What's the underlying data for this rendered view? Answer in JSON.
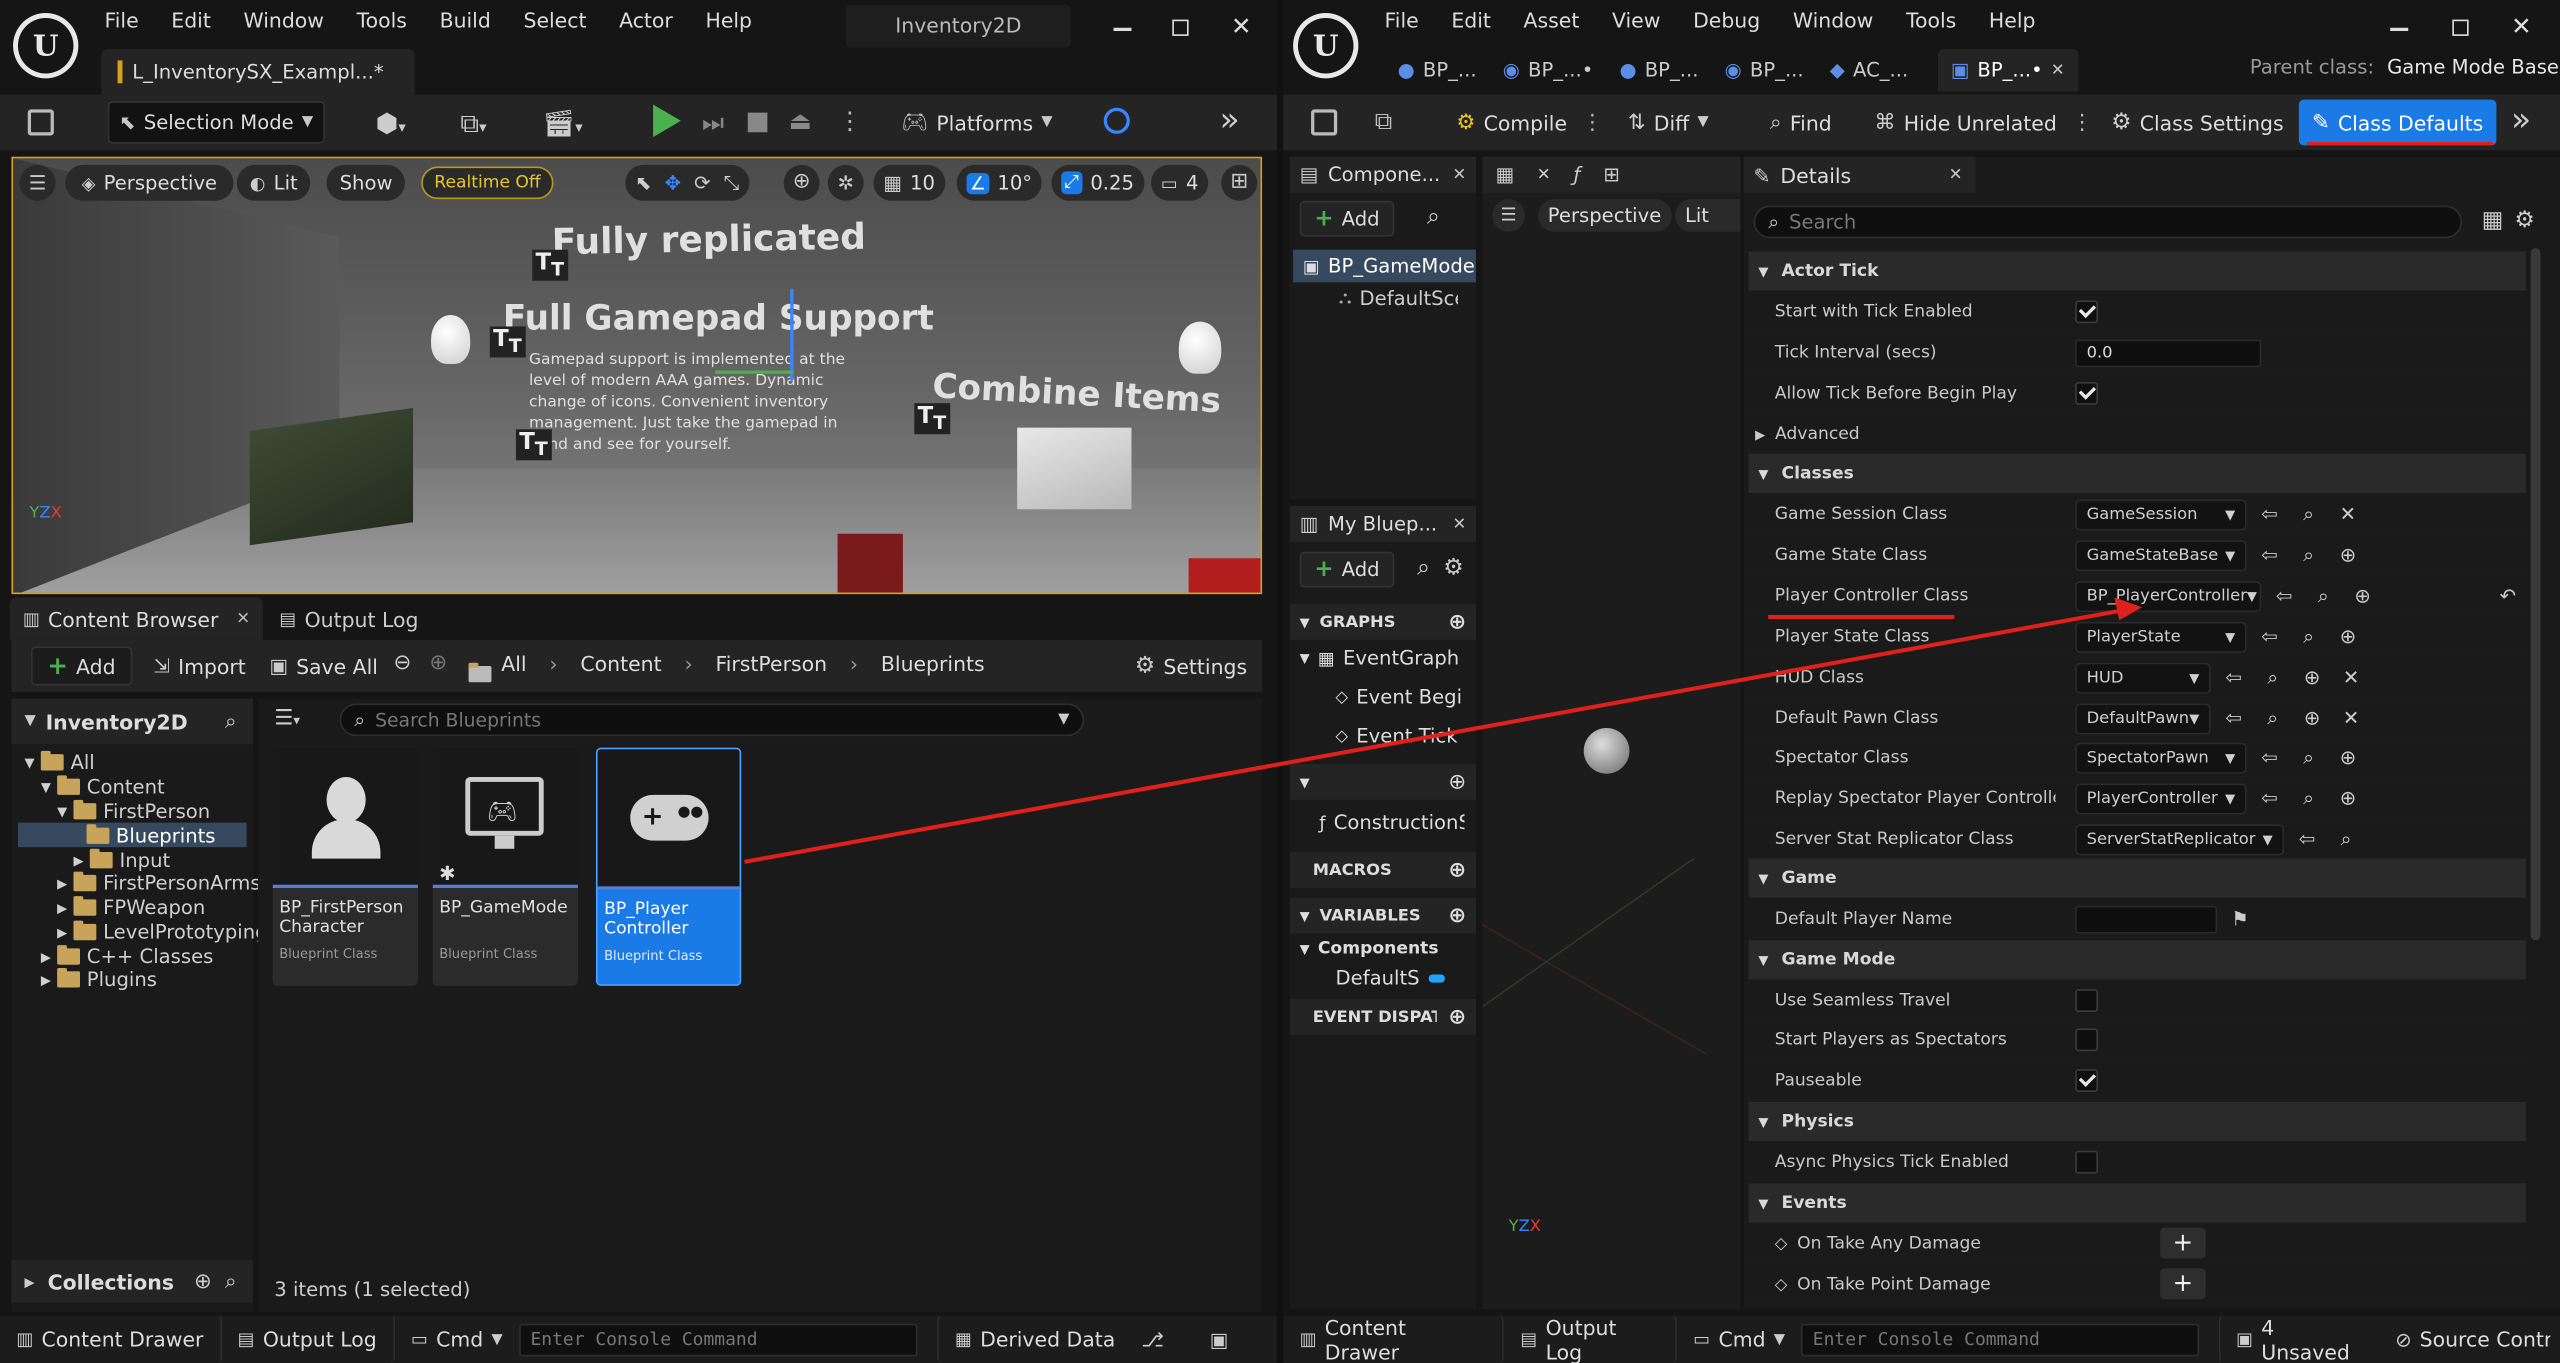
{
  "left": {
    "menu": [
      "File",
      "Edit",
      "Window",
      "Tools",
      "Build",
      "Select",
      "Actor",
      "Help"
    ],
    "project_name": "Inventory2D",
    "level_tab": "L_InventorySX_Exampl...*",
    "toolbar": {
      "mode": "Selection Mode",
      "platforms": "Platforms"
    },
    "viewport": {
      "perspective": "Perspective",
      "lit": "Lit",
      "show": "Show",
      "realtime": "Realtime Off",
      "grid": "10",
      "angle": "10°",
      "scale": "0.25",
      "cam": "4",
      "scene_text": {
        "fully_replicated": "Fully replicated",
        "gamepad_title": "Full Gamepad Support",
        "gamepad_body": "Gamepad support is implemented at the level of modern AAA games. Dynamic change of icons. Convenient inventory management. Just take the gamepad in hand and see for yourself.",
        "combine": "Combine Items"
      }
    },
    "tabs": {
      "content_browser": "Content Browser",
      "output_log": "Output Log"
    },
    "cb_toolbar": {
      "add": "Add",
      "import": "Import",
      "save_all": "Save All",
      "settings": "Settings"
    },
    "breadcrumb": [
      "All",
      "Content",
      "FirstPerson",
      "Blueprints"
    ],
    "tree": {
      "root": "Inventory2D",
      "items": [
        "All",
        "Content",
        "FirstPerson",
        "Blueprints",
        "Input",
        "FirstPersonArms",
        "FPWeapon",
        "LevelPrototyping",
        "C++ Classes",
        "Plugins"
      ]
    },
    "search_placeholder": "Search Blueprints",
    "assets": [
      {
        "name": "BP_FirstPerson Character",
        "type": "Blueprint Class"
      },
      {
        "name": "BP_GameMode",
        "type": "Blueprint Class"
      },
      {
        "name": "BP_Player Controller",
        "type": "Blueprint Class"
      }
    ],
    "collections": "Collections",
    "status": "3 items (1 selected)",
    "bottom": {
      "content_drawer": "Content Drawer",
      "output_log": "Output Log",
      "cmd": "Cmd",
      "console_placeholder": "Enter Console Command",
      "derived_data": "Derived Data"
    }
  },
  "right": {
    "menu": [
      "File",
      "Edit",
      "Asset",
      "View",
      "Debug",
      "Window",
      "Tools",
      "Help"
    ],
    "doc_tabs": [
      "BP_...",
      "BP_...•",
      "BP_...",
      "BP_...",
      "AC_...",
      "BP_...•"
    ],
    "parent_class_label": "Parent class:",
    "parent_class_value": "Game Mode Base",
    "toolbar": {
      "compile": "Compile",
      "diff": "Diff",
      "find": "Find",
      "hide_unrelated": "Hide Unrelated",
      "class_settings": "Class Settings",
      "class_defaults": "Class Defaults"
    },
    "components": {
      "tab": "Compone...",
      "add": "Add",
      "items": [
        "BP_GameMode",
        "DefaultSce"
      ]
    },
    "viewport_tab": {
      "perspective": "Perspective",
      "lit": "Lit"
    },
    "my_blueprint": {
      "tab": "My Bluep...",
      "add": "Add",
      "graphs": "GRAPHS",
      "event_graph": "EventGraph",
      "events": [
        "Event BeginP",
        "Event Tick"
      ],
      "construction": "ConstructionS",
      "macros": "MACROS",
      "variables": "VARIABLES",
      "components": "Components",
      "default_s": "DefaultS",
      "dispatchers": "EVENT DISPATC"
    },
    "details": {
      "tab": "Details",
      "search_placeholder": "Search",
      "sections": {
        "actor_tick": "Actor Tick",
        "classes": "Classes",
        "game": "Game",
        "game_mode": "Game Mode",
        "physics": "Physics",
        "events": "Events"
      },
      "actor_tick": {
        "start_tick": "Start with Tick Enabled",
        "tick_interval": "Tick Interval (secs)",
        "tick_interval_value": "0.0",
        "allow_tick": "Allow Tick Before Begin Play",
        "advanced": "Advanced"
      },
      "classes": [
        {
          "name": "Game Session Class",
          "value": "GameSession"
        },
        {
          "name": "Game State Class",
          "value": "GameStateBase"
        },
        {
          "name": "Player Controller Class",
          "value": "BP_PlayerController"
        },
        {
          "name": "Player State Class",
          "value": "PlayerState"
        },
        {
          "name": "HUD Class",
          "value": "HUD"
        },
        {
          "name": "Default Pawn Class",
          "value": "DefaultPawn"
        },
        {
          "name": "Spectator Class",
          "value": "SpectatorPawn"
        },
        {
          "name": "Replay Spectator Player Controller Cl...",
          "value": "PlayerController"
        },
        {
          "name": "Server Stat Replicator Class",
          "value": "ServerStatReplicator"
        }
      ],
      "game": {
        "default_player_name": "Default Player Name"
      },
      "game_mode": {
        "seamless": "Use Seamless Travel",
        "spectators": "Start Players as Spectators",
        "pauseable": "Pauseable"
      },
      "physics": {
        "async": "Async Physics Tick Enabled"
      },
      "events": [
        "On Take Any Damage",
        "On Take Point Damage"
      ]
    },
    "bottom": {
      "content_drawer": "Content Drawer",
      "output_log": "Output Log",
      "cmd": "Cmd",
      "console_placeholder": "Enter Console Command",
      "unsaved": "4 Unsaved",
      "source_control": "Source Control"
    }
  },
  "colors": {
    "accent": "#1a7be6",
    "annotation": "#e0201d",
    "folder": "#c8a45a",
    "play": "#4caf50"
  }
}
